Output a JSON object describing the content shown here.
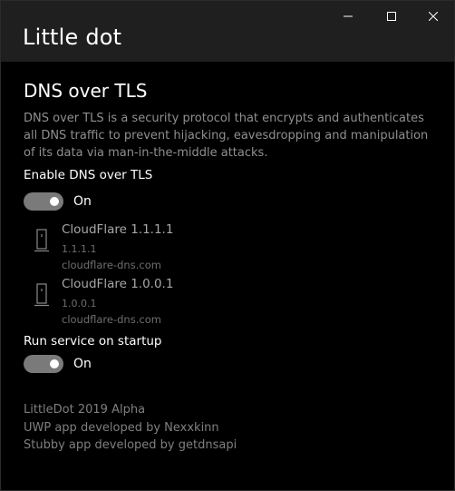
{
  "window": {
    "title": "Little dot",
    "controls": {
      "minimize": "minimize-icon",
      "maximize": "maximize-icon",
      "close": "close-icon"
    }
  },
  "dns": {
    "heading": "DNS over TLS",
    "description": "DNS over TLS is a security protocol that encrypts and authenticates all DNS traffic to prevent hijacking, eavesdropping and manipulation of its data via man-in-the-middle attacks.",
    "enable_label": "Enable DNS over TLS",
    "enable_toggle": {
      "state": true,
      "text": "On"
    },
    "servers": [
      {
        "name": "CloudFlare 1.1.1.1",
        "ip": "1.1.1.1",
        "host": "cloudflare-dns.com",
        "icon": "server-icon"
      },
      {
        "name": "CloudFlare 1.0.0.1",
        "ip": "1.0.0.1",
        "host": "cloudflare-dns.com",
        "icon": "server-icon"
      }
    ]
  },
  "startup": {
    "label": "Run service on startup",
    "toggle": {
      "state": true,
      "text": "On"
    }
  },
  "footer": {
    "line1": "LittleDot 2019 Alpha",
    "line2": "UWP app developed by Nexxkinn",
    "line3": "Stubby app developed by getdnsapi"
  },
  "colors": {
    "background": "#000000",
    "titlebar": "#1f1f1f",
    "toggle_track": "#7a7a7a",
    "muted_text": "#8f8f8f"
  }
}
